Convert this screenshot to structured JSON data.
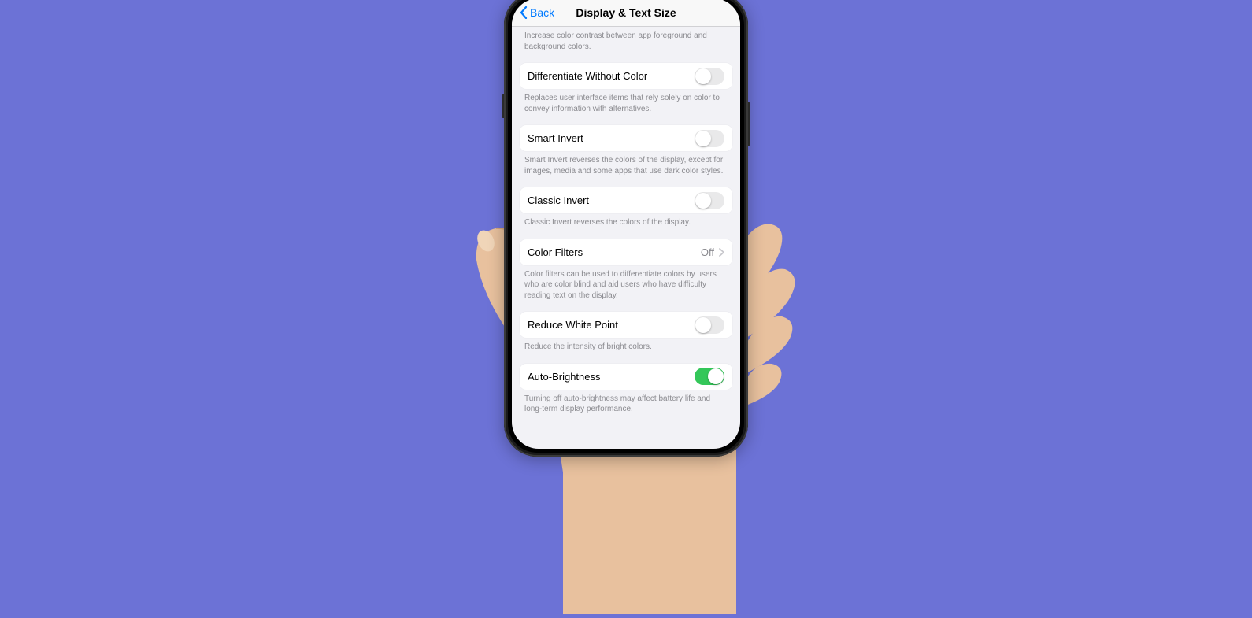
{
  "nav": {
    "back_label": "Back",
    "title": "Display & Text Size"
  },
  "sections": {
    "contrast_footer": "Increase color contrast between app foreground and background colors.",
    "differentiate": {
      "label": "Differentiate Without Color",
      "footer": "Replaces user interface items that rely solely on color to convey information with alternatives."
    },
    "smart_invert": {
      "label": "Smart Invert",
      "footer": "Smart Invert reverses the colors of the display, except for images, media and some apps that use dark color styles."
    },
    "classic_invert": {
      "label": "Classic Invert",
      "footer": "Classic Invert reverses the colors of the display."
    },
    "color_filters": {
      "label": "Color Filters",
      "value": "Off",
      "footer": "Color filters can be used to differentiate colors by users who are color blind and aid users who have difficulty reading text on the display."
    },
    "reduce_white_point": {
      "label": "Reduce White Point",
      "footer": "Reduce the intensity of bright colors."
    },
    "auto_brightness": {
      "label": "Auto-Brightness",
      "footer": "Turning off auto-brightness may affect battery life and long-term display performance."
    }
  }
}
